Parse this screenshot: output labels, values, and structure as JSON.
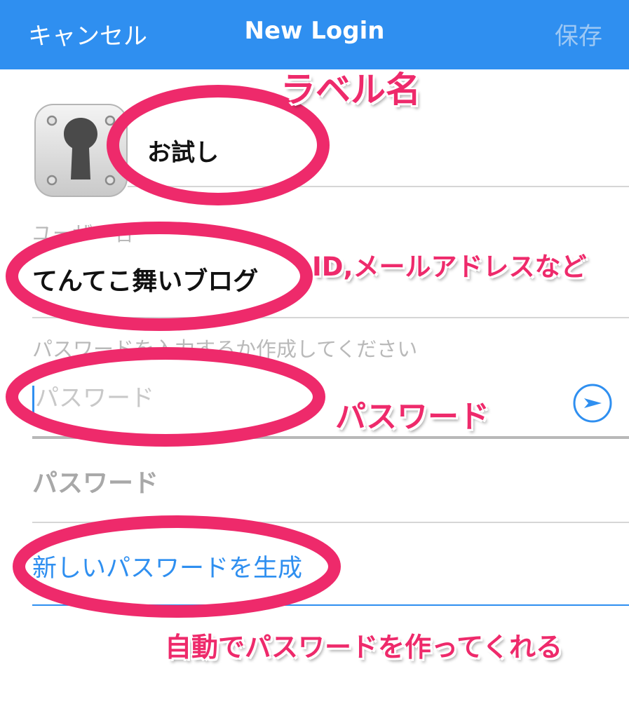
{
  "navbar": {
    "cancel_label": "キャンセル",
    "title": "New Login",
    "save_label": "保存",
    "color": "#2f8ff0"
  },
  "label_field": {
    "value": "お試し",
    "icon": "keyhole-vault-icon"
  },
  "username_field": {
    "caption": "ユーザー名",
    "value": "てんてこ舞いブログ"
  },
  "password_field": {
    "hint": "パスワードを入力するか作成してください",
    "placeholder": "パスワード",
    "arrow_icon": "circle-arrow-right-icon"
  },
  "password_section_label": "パスワード",
  "generate_link": "新しいパスワードを生成",
  "annotations": {
    "label_name": "ラベル名",
    "id_email": "ID,メールアドレスなど",
    "password": "パスワード",
    "auto_generate": "自動でパスワードを作ってくれる",
    "color": "#ee2a6b"
  }
}
